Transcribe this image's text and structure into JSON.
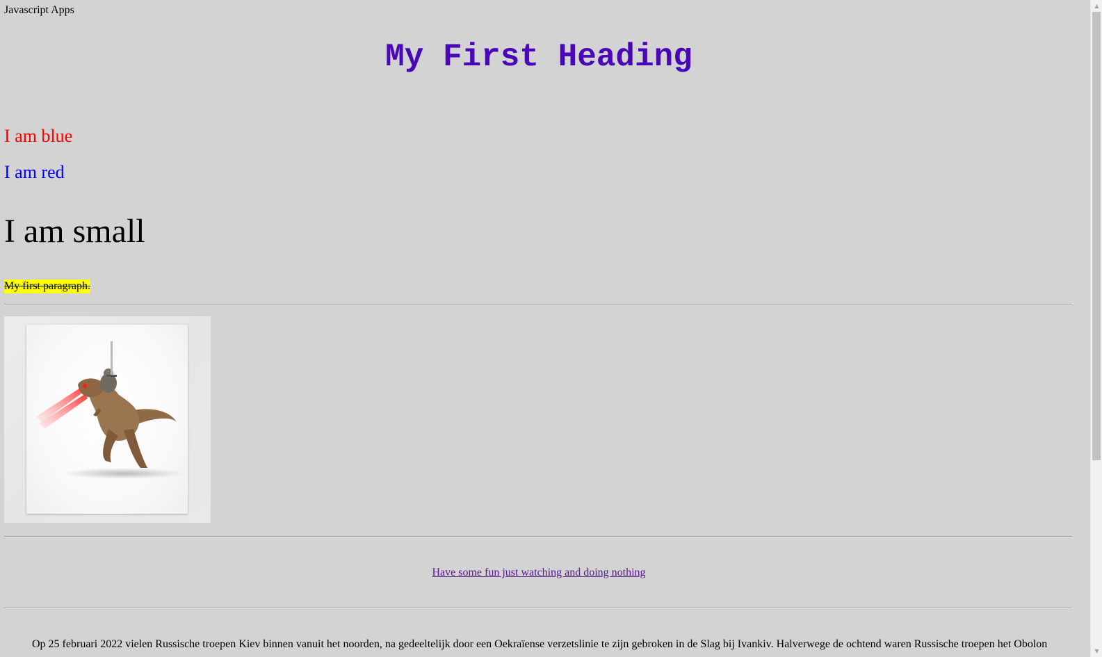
{
  "page": {
    "site_title": "Javascript Apps",
    "heading": "My First Heading",
    "blue_text": "I am blue",
    "red_text": "I am red",
    "small_text": "I am small",
    "first_paragraph": "My first paragraph.",
    "link_text": "Have some fun just watching and doing nothing",
    "article_text": "Op 25 februari 2022 vielen Russische troepen Kiev binnen vanuit het noorden, na gedeeltelijk door een Oekraïense verzetslinie te zijn gebroken in de Slag bij Ivankiv. Halverwege de ochtend waren Russische troepen het Obolon-"
  },
  "image": {
    "subject": "t-rex-with-laser-eyes-and-sloth-rider"
  },
  "colors": {
    "background": "#d3d3d3",
    "heading": "#4a07b8",
    "blue_text_color": "#ff0000",
    "red_text_color": "#0000ff",
    "highlight": "#ffff00",
    "visited_link": "#551a8b"
  },
  "icons": {
    "scroll_up": "up-arrow-icon",
    "scroll_down": "down-arrow-icon"
  }
}
